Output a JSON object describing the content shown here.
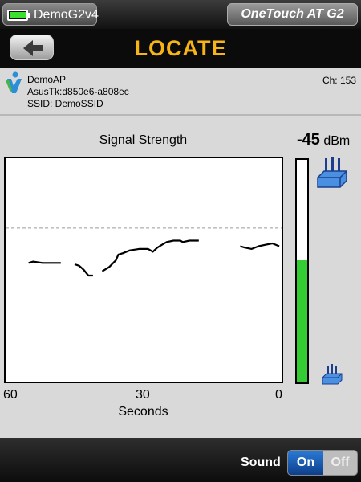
{
  "status_bar": {
    "device_name": "DemoG2v4",
    "product": "OneTouch AT G2",
    "battery_icon": "battery-icon"
  },
  "header": {
    "title": "LOCATE",
    "back_icon": "back-arrow-icon"
  },
  "ap": {
    "name": "DemoAP",
    "mac": "AsusTk:d850e6-a808ec",
    "ssid": "SSID: DemoSSID",
    "channel": "Ch: 153",
    "icon": "ap-person-icon"
  },
  "chart_data": {
    "type": "line",
    "title": "Signal Strength",
    "xlabel": "Seconds",
    "ylabel": "",
    "x_ticks": [
      "60",
      "30",
      "0"
    ],
    "xlim": [
      60,
      0
    ],
    "ylim": [
      -100,
      -20
    ],
    "reference_level": -45,
    "segments": [
      [
        [
          55,
          -57.5
        ],
        [
          54,
          -57
        ],
        [
          52,
          -57.5
        ],
        [
          48,
          -57.5
        ]
      ],
      [
        [
          45,
          -58
        ],
        [
          44,
          -58.5
        ],
        [
          43,
          -60
        ],
        [
          42,
          -62
        ],
        [
          41,
          -62
        ]
      ],
      [
        [
          39,
          -60.5
        ],
        [
          37.5,
          -59
        ],
        [
          36,
          -56.5
        ],
        [
          35.5,
          -54.5
        ],
        [
          34.5,
          -54
        ],
        [
          33,
          -53
        ],
        [
          31,
          -52.5
        ],
        [
          29,
          -52.5
        ],
        [
          28,
          -53.5
        ],
        [
          27,
          -52
        ],
        [
          26,
          -51
        ],
        [
          25,
          -50
        ],
        [
          23.5,
          -49.5
        ],
        [
          22,
          -49.5
        ],
        [
          21.5,
          -50
        ],
        [
          20,
          -49.5
        ],
        [
          18,
          -49.5
        ]
      ],
      [
        [
          9,
          -51.5
        ],
        [
          8,
          -52
        ],
        [
          6.5,
          -52.5
        ],
        [
          5,
          -51.5
        ],
        [
          3.5,
          -51
        ],
        [
          2,
          -50.5
        ],
        [
          0.5,
          -51.5
        ]
      ]
    ],
    "line_color": "#000000"
  },
  "meter": {
    "dbm_value": "-45",
    "dbm_unit": "dBm",
    "level_fraction": 0.55,
    "fill_color": "#33cc33",
    "strong_icon": "router-large-icon",
    "weak_icon": "router-small-icon"
  },
  "footer": {
    "sound_label": "Sound",
    "toggle_on_label": "On",
    "toggle_off_label": "Off",
    "selected": "On"
  }
}
